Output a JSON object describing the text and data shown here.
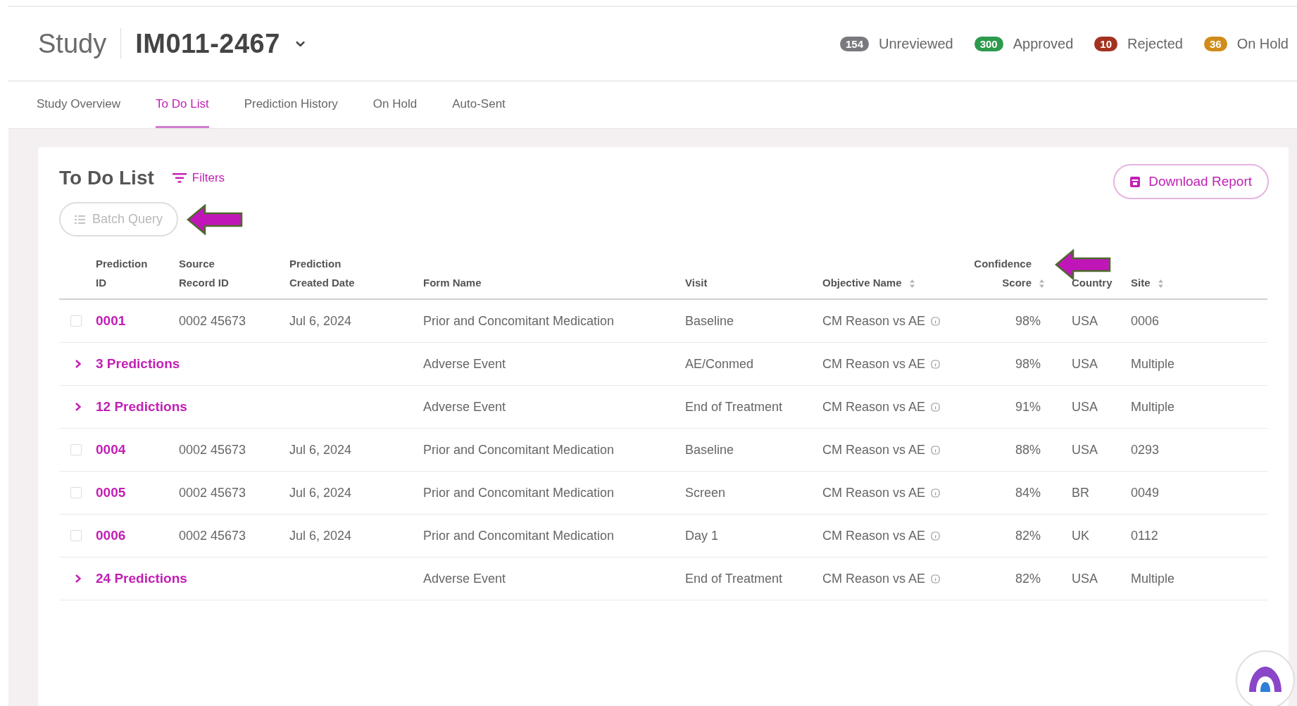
{
  "header": {
    "label": "Study",
    "study": "IM011-2467",
    "chevron": "⌄"
  },
  "status_counts": [
    {
      "count": "154",
      "label": "Unreviewed",
      "color": "#7a7a7e"
    },
    {
      "count": "300",
      "label": "Approved",
      "color": "#2e9a4c"
    },
    {
      "count": "10",
      "label": "Rejected",
      "color": "#a3321f"
    },
    {
      "count": "36",
      "label": "On Hold",
      "color": "#d08c1a"
    }
  ],
  "tabs": [
    {
      "label": "Study Overview",
      "selected": false
    },
    {
      "label": "To Do List",
      "selected": true
    },
    {
      "label": "Prediction History",
      "selected": false
    },
    {
      "label": "On Hold",
      "selected": false
    },
    {
      "label": "Auto-Sent",
      "selected": false
    }
  ],
  "panel": {
    "title": "To Do List",
    "filters": "Filters",
    "batch_query": "Batch Query",
    "download": "Download Report"
  },
  "table": {
    "columns": [
      {
        "lines": [
          "Prediction",
          "ID"
        ],
        "sortable": false
      },
      {
        "lines": [
          "Source",
          "Record ID"
        ],
        "sortable": false
      },
      {
        "lines": [
          "Prediction",
          "Created Date"
        ],
        "sortable": false
      },
      {
        "lines": [
          "Form Name"
        ],
        "sortable": false
      },
      {
        "lines": [
          "Visit"
        ],
        "sortable": false
      },
      {
        "lines": [
          "Objective Name"
        ],
        "sortable": true
      },
      {
        "lines": [
          "Confidence",
          "Score"
        ],
        "sortable": true
      },
      {
        "lines": [
          "Country"
        ],
        "sortable": false
      },
      {
        "lines": [
          "Site"
        ],
        "sortable": true
      }
    ],
    "rows": [
      {
        "kind": "prediction",
        "checked": false,
        "id": "0001",
        "source": "0002 45673",
        "date": "Jul 6, 2024",
        "form": "Prior and Concomitant Medication",
        "visit": "Baseline",
        "objective": "CM Reason vs AE",
        "score": "98%",
        "country": "USA",
        "site": "0006"
      },
      {
        "kind": "group",
        "expanded": false,
        "id": "3 Predictions",
        "form": "Adverse Event",
        "visit": "AE/Conmed",
        "objective": "CM Reason vs AE",
        "score": "98%",
        "country": "USA",
        "site": "Multiple"
      },
      {
        "kind": "group",
        "expanded": false,
        "id": "12 Predictions",
        "form": "Adverse Event",
        "visit": "End of Treatment",
        "objective": "CM Reason vs AE",
        "score": "91%",
        "country": "USA",
        "site": "Multiple"
      },
      {
        "kind": "prediction",
        "checked": false,
        "id": "0004",
        "source": "0002 45673",
        "date": "Jul 6, 2024",
        "form": "Prior and Concomitant Medication",
        "visit": "Baseline",
        "objective": "CM Reason vs AE",
        "score": "88%",
        "country": "USA",
        "site": "0293"
      },
      {
        "kind": "prediction",
        "checked": false,
        "id": "0005",
        "source": "0002 45673",
        "date": "Jul 6, 2024",
        "form": "Prior and Concomitant Medication",
        "visit": "Screen",
        "objective": "CM Reason vs AE",
        "score": "84%",
        "country": "BR",
        "site": "0049"
      },
      {
        "kind": "prediction",
        "checked": false,
        "id": "0006",
        "source": "0002 45673",
        "date": "Jul 6, 2024",
        "form": "Prior and Concomitant Medication",
        "visit": "Day 1",
        "objective": "CM Reason vs AE",
        "score": "82%",
        "country": "UK",
        "site": "0112"
      },
      {
        "kind": "group",
        "expanded": false,
        "id": "24 Predictions",
        "form": "Adverse Event",
        "visit": "End of Treatment",
        "objective": "CM Reason vs AE",
        "score": "82%",
        "country": "USA",
        "site": "Multiple"
      }
    ]
  }
}
